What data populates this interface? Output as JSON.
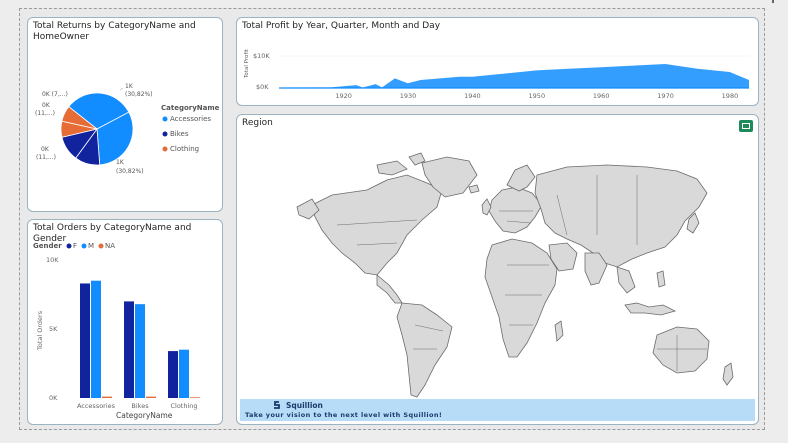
{
  "colors": {
    "accessories": "#118DFF",
    "bikes": "#12239E",
    "clothing": "#E66C37",
    "profit_line": "#118DFF",
    "map_land": "#d9d9d9",
    "map_border": "#6b6b6b"
  },
  "returns_pie": {
    "title_line1": "Total Returns by CategoryName and",
    "title_line2": "HomeOwner",
    "legend_title": "CategoryName",
    "legend_items": [
      "Accessories",
      "Bikes",
      "Clothing"
    ],
    "labels": [
      {
        "line1": "1K",
        "line2": "(30,82%)"
      },
      {
        "line1": "1K",
        "line2": "(30,82%)"
      },
      {
        "line1": "0K",
        "line2": "(11,...)"
      },
      {
        "line1": "0K",
        "line2": "(11,...)"
      },
      {
        "line1": "0K (7,...)",
        "line2": ""
      }
    ]
  },
  "profit_chart": {
    "title": "Total Profit by Year, Quarter, Month and Day",
    "ylabel": "Total Profit",
    "y_ticks": [
      "$10K",
      "$0K"
    ],
    "x_ticks": [
      "1920",
      "1930",
      "1940",
      "1950",
      "1960",
      "1970",
      "1980"
    ]
  },
  "map": {
    "title": "Region",
    "brand": "Squillion",
    "tagline": "Take your vision to the next level with Squillion!"
  },
  "orders_chart": {
    "title": "Total Orders by CategoryName and Gender",
    "legend_title": "Gender",
    "legend_items": [
      "F",
      "M",
      "NA"
    ],
    "y_ticks": [
      "10K",
      "5K",
      "0K"
    ],
    "ylabel": "Total Orders",
    "xlabel": "CategoryName"
  },
  "chart_data": [
    {
      "type": "pie",
      "title": "Total Returns by CategoryName and HomeOwner",
      "legend": [
        "Accessories",
        "Bikes",
        "Clothing"
      ],
      "slices": [
        {
          "category": "Accessories",
          "value": 30.82
        },
        {
          "category": "Accessories",
          "value": 30.82
        },
        {
          "category": "Bikes",
          "value": 11
        },
        {
          "category": "Bikes",
          "value": 11
        },
        {
          "category": "Clothing",
          "value": 7
        },
        {
          "category": "Clothing",
          "value": 7
        }
      ]
    },
    {
      "type": "area",
      "title": "Total Profit by Year, Quarter, Month and Day",
      "ylabel": "Total Profit",
      "y_range": [
        0,
        10000
      ],
      "x_range": [
        1910,
        1983
      ],
      "points": [
        [
          1910,
          150
        ],
        [
          1918,
          200
        ],
        [
          1922,
          900
        ],
        [
          1923,
          150
        ],
        [
          1925,
          1200
        ],
        [
          1926,
          200
        ],
        [
          1928,
          3000
        ],
        [
          1930,
          1500
        ],
        [
          1932,
          2500
        ],
        [
          1935,
          3000
        ],
        [
          1938,
          3500
        ],
        [
          1940,
          3500
        ],
        [
          1945,
          4500
        ],
        [
          1950,
          5500
        ],
        [
          1955,
          6000
        ],
        [
          1960,
          6500
        ],
        [
          1965,
          7000
        ],
        [
          1970,
          7500
        ],
        [
          1975,
          6000
        ],
        [
          1980,
          5000
        ],
        [
          1983,
          2500
        ]
      ]
    },
    {
      "type": "bar",
      "title": "Total Orders by CategoryName and Gender",
      "xlabel": "CategoryName",
      "ylabel": "Total Orders",
      "categories": [
        "Accessories",
        "Bikes",
        "Clothing"
      ],
      "ylim": [
        0,
        10000
      ],
      "series": [
        {
          "name": "F",
          "values": [
            8300,
            7000,
            3400
          ]
        },
        {
          "name": "M",
          "values": [
            8500,
            6800,
            3500
          ]
        },
        {
          "name": "NA",
          "values": [
            100,
            100,
            50
          ]
        }
      ]
    }
  ]
}
